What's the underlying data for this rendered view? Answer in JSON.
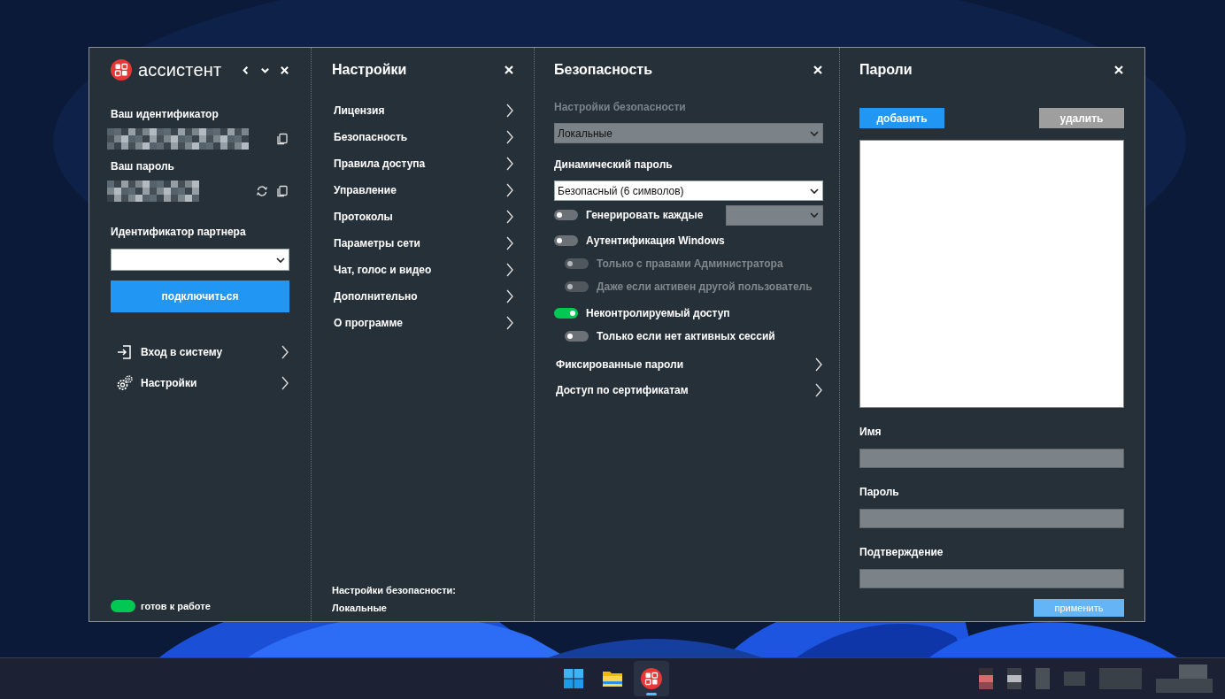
{
  "app": {
    "name": "ассистент"
  },
  "main": {
    "id_label": "Ваш идентификатор",
    "password_label": "Ваш пароль",
    "partner_label": "Идентификатор партнера",
    "connect": "подключиться",
    "links": [
      {
        "label": "Вход в систему",
        "kind": "login"
      },
      {
        "label": "Настройки",
        "kind": "settings"
      }
    ],
    "status": {
      "label": "готов к работе",
      "color": "#00c853"
    }
  },
  "settings": {
    "title": "Настройки",
    "items": [
      "Лицензия",
      "Безопасность",
      "Правила доступа",
      "Управление",
      "Протоколы",
      "Параметры сети",
      "Чат, голос и видео",
      "Дополнительно",
      "О программе"
    ],
    "footer": [
      "Настройки безопасности:",
      "Локальные"
    ]
  },
  "security": {
    "title": "Безопасность",
    "rows": [
      {
        "kind": "select",
        "label": "Настройки безопасности",
        "value": "Локальные",
        "disabled": true
      },
      {
        "kind": "select",
        "label": "Динамический пароль",
        "value": "Безопасный (6 символов)",
        "disabled": false
      },
      {
        "kind": "toggle",
        "label": "Генерировать каждые",
        "on": false,
        "disabled": false,
        "with_select": true
      },
      {
        "kind": "toggle",
        "label": "Аутентификация Windows",
        "on": false,
        "disabled": false,
        "children": [
          {
            "label": "Только с правами Администратора",
            "on": false,
            "disabled": true
          },
          {
            "label": "Даже если активен другой пользователь",
            "on": false,
            "disabled": true
          }
        ]
      },
      {
        "kind": "toggle",
        "label": "Неконтролируемый доступ",
        "on": true,
        "disabled": false,
        "children": [
          {
            "label": "Только если нет активных сессий",
            "on": false,
            "disabled": false
          }
        ]
      },
      {
        "kind": "link",
        "label": "Фиксированные пароли"
      },
      {
        "kind": "link",
        "label": "Доступ по сертификатам"
      }
    ]
  },
  "passwords": {
    "title": "Пароли",
    "buttons": [
      {
        "label": "добавить",
        "kind": "primary",
        "disabled": false
      },
      {
        "label": "удалить",
        "kind": "neutral",
        "disabled": true
      }
    ],
    "fields": [
      "Имя",
      "Пароль",
      "Подтверждение"
    ],
    "apply": {
      "label": "применить",
      "kind": "primary",
      "disabled": true
    }
  },
  "taskbar": {
    "items": [
      {
        "kind": "start",
        "selected": false
      },
      {
        "kind": "folder",
        "selected": false
      },
      {
        "kind": "app",
        "selected": true
      }
    ]
  }
}
